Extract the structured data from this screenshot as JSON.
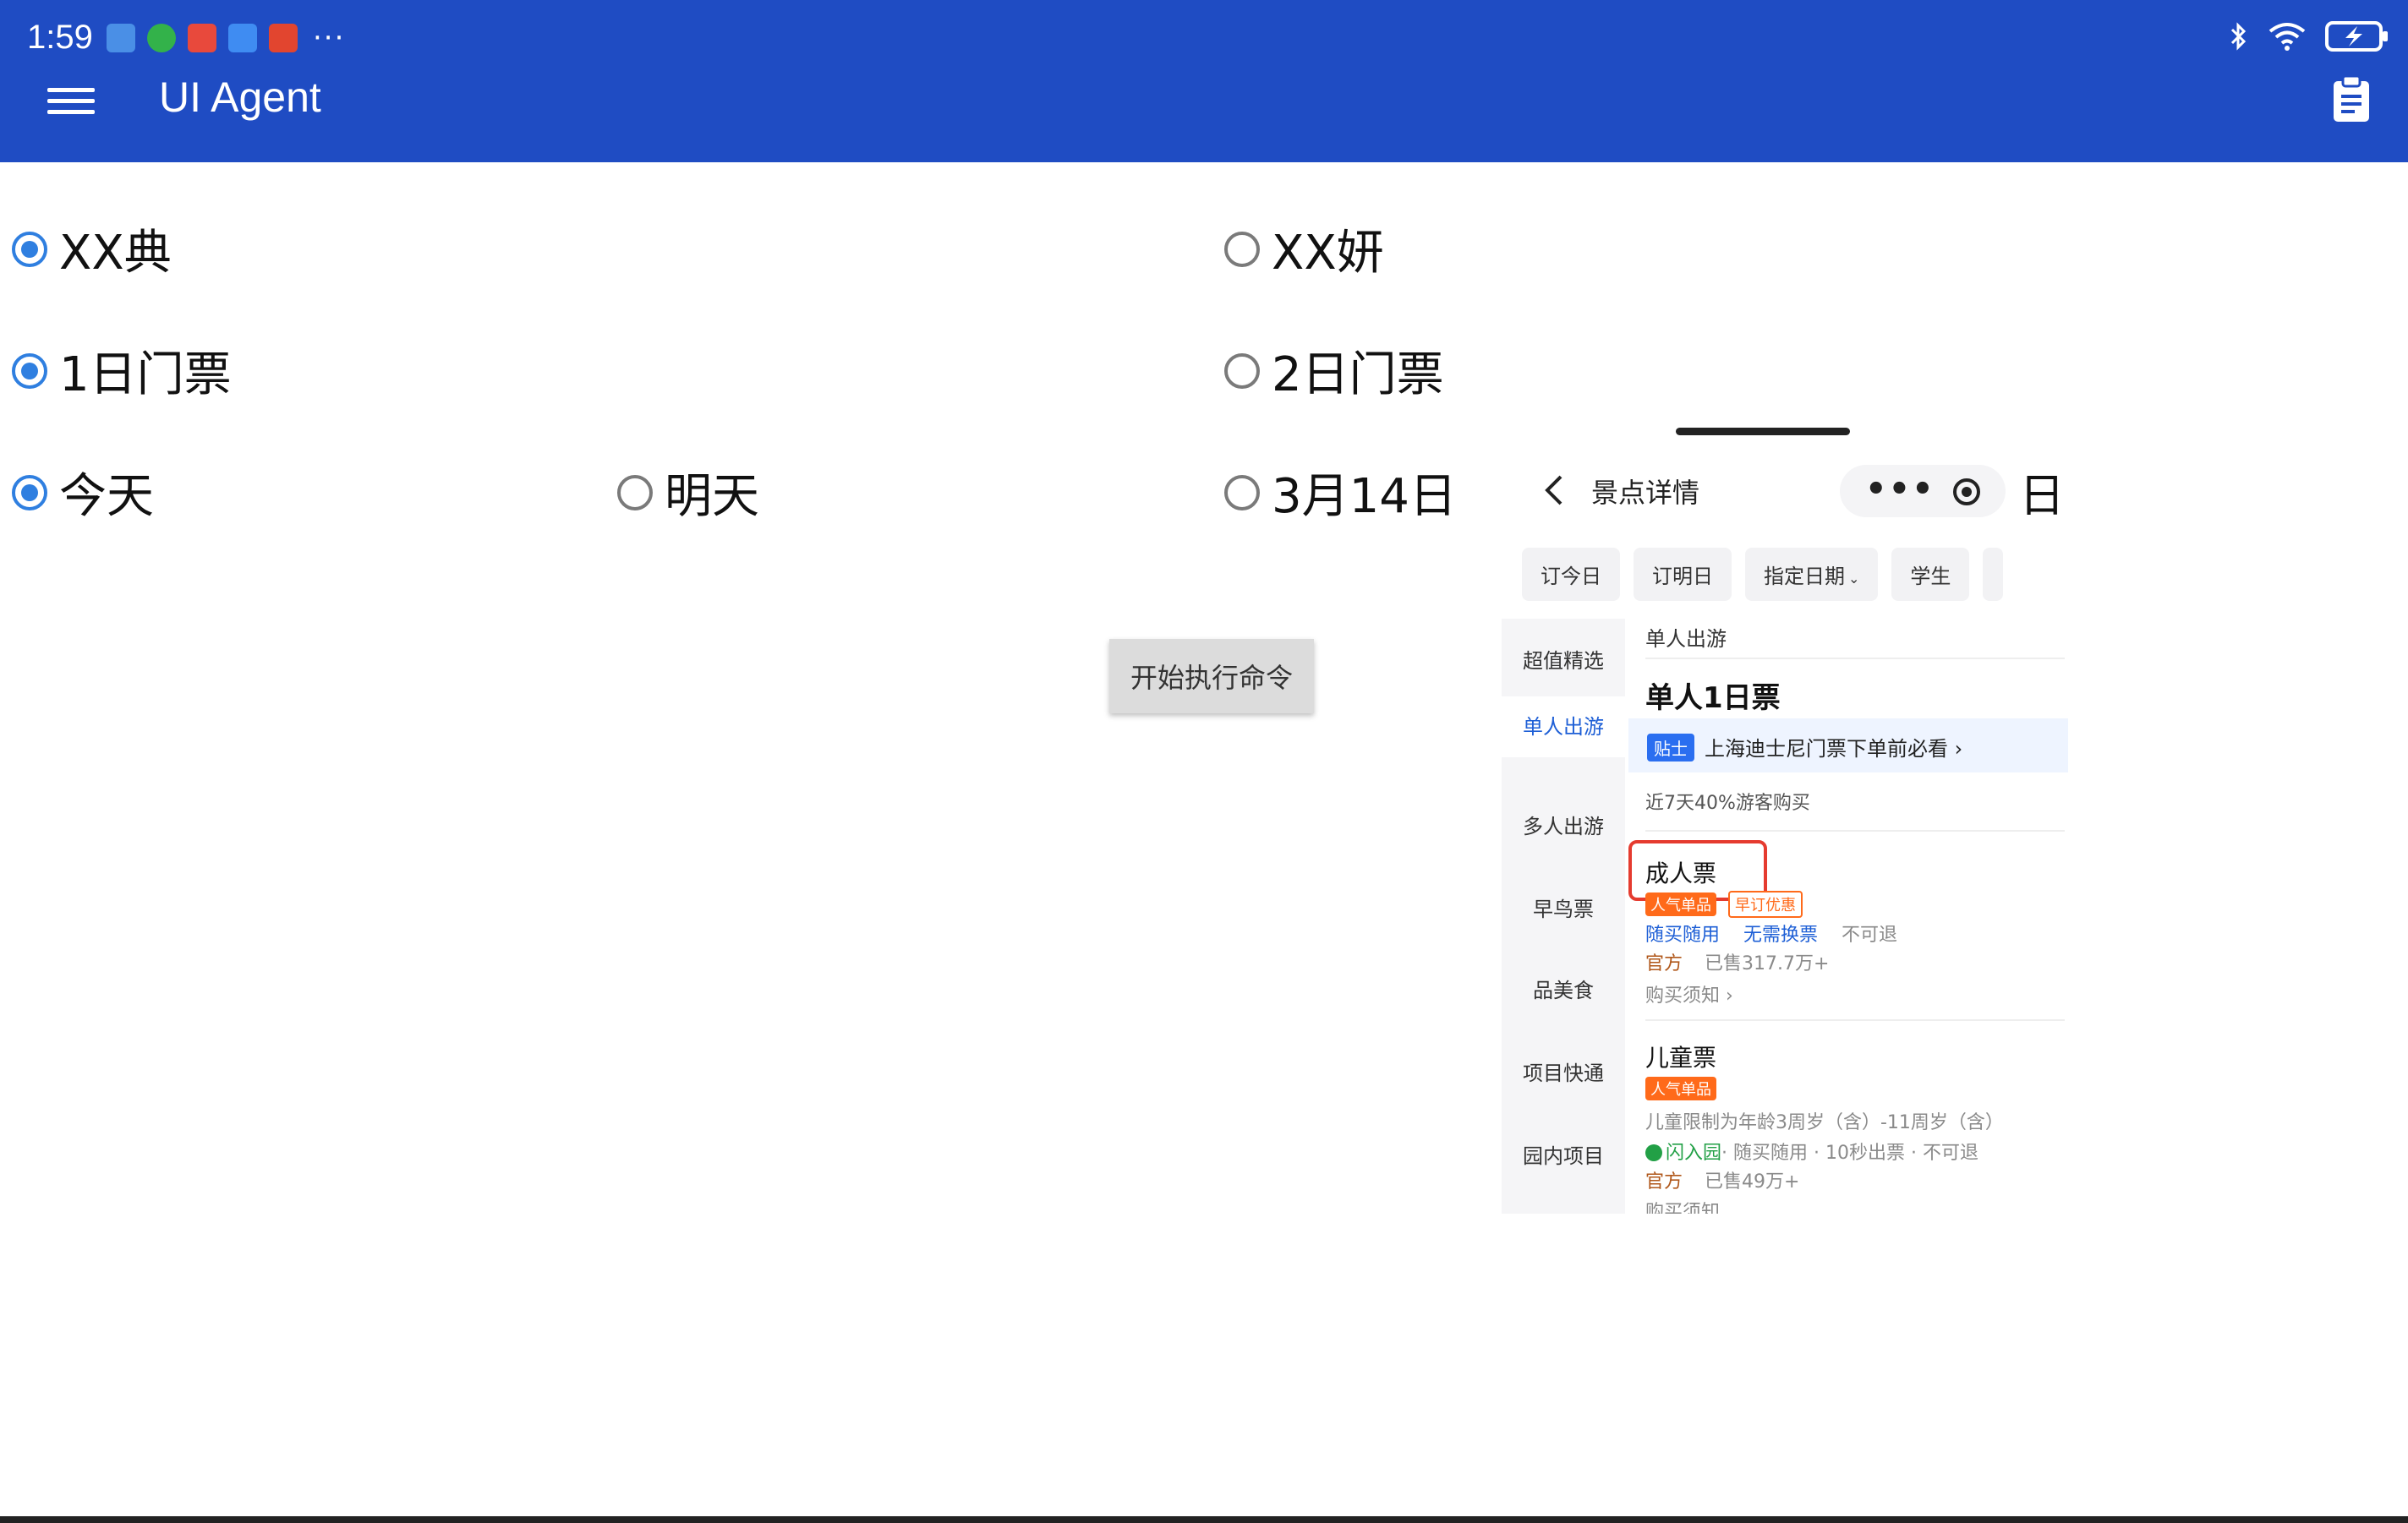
{
  "status_bar": {
    "time": "1:59",
    "more": "···",
    "app_icons": [
      {
        "name": "usb-notification-icon",
        "color": "#4a8fe6"
      },
      {
        "name": "green-app-icon",
        "color": "#33b24a"
      },
      {
        "name": "red-app-icon",
        "color": "#e8493c"
      },
      {
        "name": "blue-app-icon",
        "color": "#3f8cf2"
      },
      {
        "name": "orange-app-icon",
        "color": "#e2452f"
      }
    ]
  },
  "app_bar": {
    "title": "UI Agent",
    "color": "#1f4cc3"
  },
  "options": {
    "row1": [
      {
        "label": "XX典",
        "checked": true
      },
      {
        "label": "XX妍",
        "checked": false
      }
    ],
    "row2": [
      {
        "label": "1日门票",
        "checked": true
      },
      {
        "label": "2日门票",
        "checked": false
      }
    ],
    "row3": [
      {
        "label": "今天",
        "checked": true
      },
      {
        "label": "明天",
        "checked": false
      },
      {
        "label": "3月14日",
        "checked": false
      }
    ]
  },
  "run_button": {
    "label": "开始执行命令"
  },
  "phone": {
    "nav_title": "景点详情",
    "nav_more": "•••",
    "nav_extra": "日",
    "chips": [
      "订今日",
      "订明日",
      "指定日期",
      "学生"
    ],
    "chip_caret": "⌄",
    "sidebar": [
      "超值精选",
      "单人出游",
      "多人出游",
      "早鸟票",
      "品美食",
      "项目快通",
      "园内项目"
    ],
    "sidebar_active": "单人出游",
    "section_header": "单人出游",
    "product_title": "单人1日票",
    "tip_badge": "贴士",
    "tip_text": "上海迪士尼门票下单前必看 ›",
    "popularity": "近7天40%游客购买",
    "adult": {
      "name": "成人票",
      "tags": [
        "人气单品",
        "早订优惠"
      ],
      "features": [
        "随买随用",
        "无需换票",
        "不可退"
      ],
      "official": "官方",
      "sold": "已售317.7万+",
      "notice": "购买须知 ›"
    },
    "child": {
      "name": "儿童票",
      "tag": "人气单品",
      "restriction": "儿童限制为年龄3周岁（含）-11周岁（含）",
      "flash": "闪入园",
      "features": "· 随买随用 · 10秒出票 · 不可退",
      "official": "官方",
      "sold": "已售49万+",
      "notice": "购买须知"
    }
  }
}
